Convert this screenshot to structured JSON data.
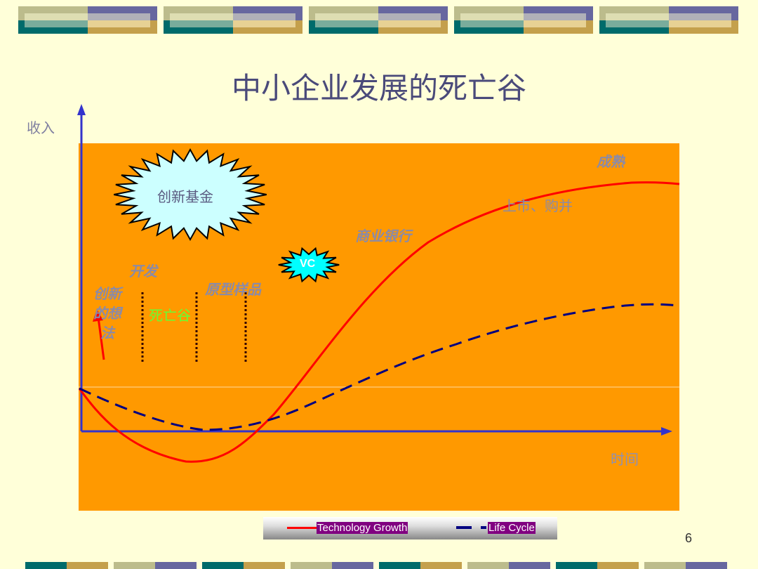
{
  "title": "中小企业发展的死亡谷",
  "axes": {
    "y_label": "收入",
    "x_label": "时间"
  },
  "annotations": {
    "fund": "创新基金",
    "vc": "VC",
    "idea": [
      "创新",
      "的想",
      "法"
    ],
    "dev": "开发",
    "prototype": "原型样品",
    "death_valley": "死亡谷",
    "bank": "商业银行",
    "ipo": "上市、购并",
    "mature": "成熟"
  },
  "legend": {
    "series": [
      {
        "name": "Technology Growth",
        "color": "#ff0000"
      },
      {
        "name": "Life Cycle",
        "color": "#000080"
      }
    ]
  },
  "colors": {
    "background": "#ffffd9",
    "chart_bg": "#ff9900",
    "axis": "#3333cc",
    "death_valley": "#66ff33"
  },
  "page_number": "6"
}
